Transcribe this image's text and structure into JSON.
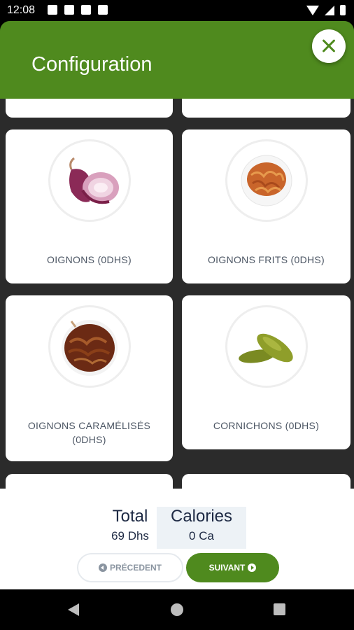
{
  "status_bar": {
    "time": "12:08"
  },
  "header": {
    "title": "Configuration"
  },
  "items": [
    {
      "label": "OIGNONS (0DHS)",
      "image": "onion-image"
    },
    {
      "label": "OIGNONS FRITS (0DHS)",
      "image": "fried-onions-image"
    },
    {
      "label": "OIGNONS CARAMÉLISÉS (0DHS)",
      "image": "caramelized-onions-image"
    },
    {
      "label": "CORNICHONS (0DHS)",
      "image": "pickles-image"
    }
  ],
  "summary": {
    "total_label": "Total",
    "total_value": "69 Dhs",
    "calories_label": "Calories",
    "calories_value": "0 Ca"
  },
  "buttons": {
    "prev_label": "PRÉCEDENT",
    "next_label": "SUIVANT"
  },
  "colors": {
    "brand_green": "#4f8a1e",
    "text_dark": "#1e2a44"
  }
}
